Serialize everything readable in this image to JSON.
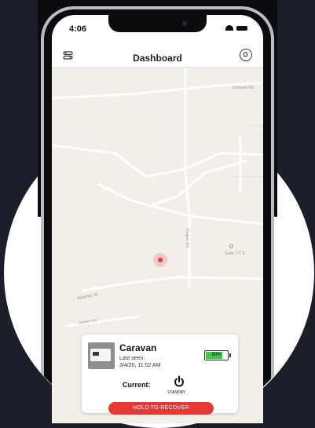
{
  "status_bar": {
    "time": "4:06"
  },
  "header": {
    "title": "Dashboard"
  },
  "map": {
    "road_labels": [
      "Hanover Rd",
      "Atlantic St",
      "Rogers Rd",
      "Ingram Rd",
      "Gunn J C E"
    ]
  },
  "device_card": {
    "name": "Caravan",
    "last_seen_label": "Last seen:",
    "last_seen_value": "3/4/20, 11:52 AM",
    "battery_percent": 80,
    "battery_text": "80%",
    "current_label": "Current:",
    "mode": "STANDBY",
    "recover_button": "HOLD TO RECOVER"
  },
  "colors": {
    "accent": "#e53935",
    "battery": "#43c64a",
    "map_bg": "#f2efe8",
    "page_bg": "#1c1f2a"
  },
  "icons": [
    "menu-icon",
    "bell-icon",
    "location-pin-icon",
    "power-icon",
    "wifi-icon",
    "battery-icon"
  ]
}
